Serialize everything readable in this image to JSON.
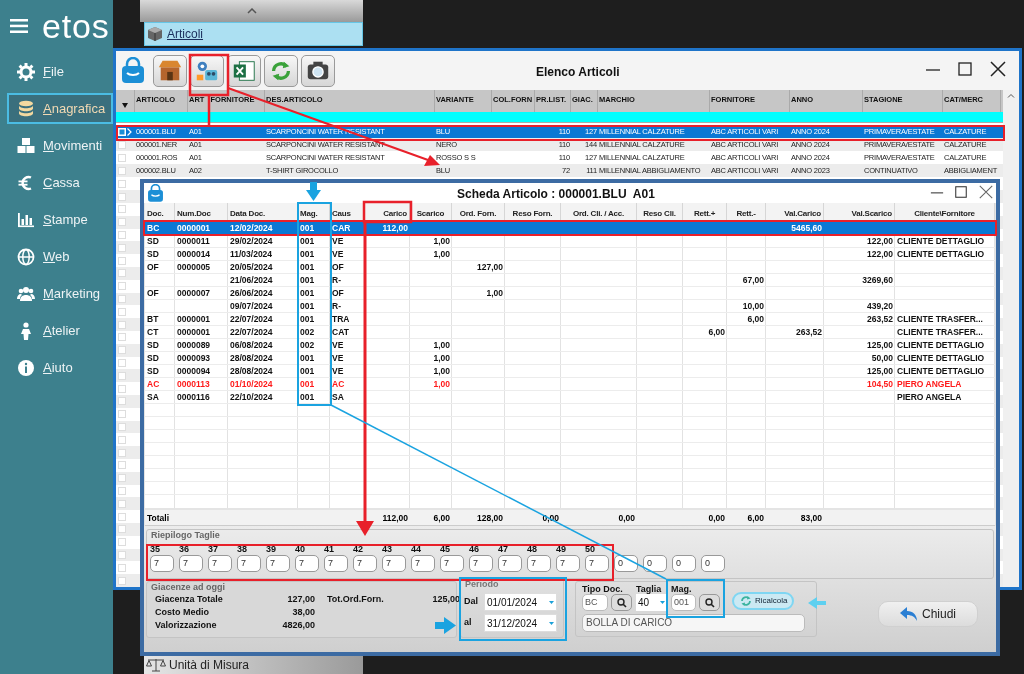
{
  "sidebar": {
    "logo": "etos",
    "items": [
      {
        "label": "File",
        "selected": false
      },
      {
        "label": "Anagrafica",
        "selected": true
      },
      {
        "label": "Movimenti",
        "selected": false
      },
      {
        "label": "Cassa",
        "selected": false
      },
      {
        "label": "Stampe",
        "selected": false
      },
      {
        "label": "Web",
        "selected": false
      },
      {
        "label": "Marketing",
        "selected": false
      },
      {
        "label": "Atelier",
        "selected": false
      },
      {
        "label": "Aiuto",
        "selected": false
      }
    ]
  },
  "top_tab": {
    "label": "Articoli"
  },
  "bottom_tab": {
    "label": "Unità di Misura"
  },
  "list_window": {
    "title": "Elenco Articoli",
    "columns": [
      "ARTICOLO",
      "ART FORNITORE",
      "DES.ARTICOLO",
      "VARIANTE",
      "COL.FORN",
      "PR.LIST.",
      "GIAC.",
      "MARCHIO",
      "FORNITORE",
      "ANNO",
      "STAGIONE",
      "CAT/MERC"
    ],
    "rows": [
      {
        "selected": true,
        "cells": [
          "000001.BLU",
          "A01",
          "SCARPONCINI WATER RESISTANT",
          "BLU",
          "",
          "110",
          "127",
          "MILLENNIAL CALZATURE",
          "ABC ARTICOLI VARI",
          "ANNO 2024",
          "PRIMAVERA/ESTATE",
          "CALZATURE"
        ]
      },
      {
        "selected": false,
        "cells": [
          "000001.NER",
          "A01",
          "SCARPONCINI WATER RESISTANT",
          "NERO",
          "",
          "110",
          "144",
          "MILLENNIAL CALZATURE",
          "ABC ARTICOLI VARI",
          "ANNO 2024",
          "PRIMAVERA/ESTATE",
          "CALZATURE"
        ]
      },
      {
        "selected": false,
        "cells": [
          "000001.ROS",
          "A01",
          "SCARPONCINI WATER RESISTANT",
          "ROSSO S S",
          "",
          "110",
          "127",
          "MILLENNIAL CALZATURE",
          "ABC ARTICOLI VARI",
          "ANNO 2024",
          "PRIMAVERA/ESTATE",
          "CALZATURE"
        ]
      },
      {
        "selected": false,
        "cells": [
          "000002.BLU",
          "A02",
          "T-SHIRT GIROCOLLO",
          "BLU",
          "",
          "72",
          "111",
          "MILLENNIAL ABBIGLIAMENTO",
          "ABC ARTICOLI VARI",
          "ANNO 2023",
          "CONTINUATIVO",
          "ABBIGLIAMENT"
        ]
      }
    ]
  },
  "detail_window": {
    "title": "Scheda Articolo : 000001.BLU  A01",
    "columns": [
      "Doc.",
      "Num.Doc",
      "Data Doc.",
      "Mag.",
      "Caus",
      "Carico",
      "Scarico",
      "Ord. Forn.",
      "Reso Forn.",
      "Ord. Cli. / Acc.",
      "Reso Cli.",
      "Rett.+",
      "Rett.-",
      "Val.Carico",
      "Val.Scarico",
      "Cliente\\Fornitore"
    ],
    "rows": [
      {
        "selected": true,
        "alert": false,
        "cells": [
          "BC",
          "0000001",
          "12/02/2024",
          "001",
          "CAR",
          "112,00",
          "",
          "",
          "",
          "",
          "",
          "",
          "",
          "5465,60",
          "",
          ""
        ]
      },
      {
        "selected": false,
        "alert": false,
        "cells": [
          "SD",
          "0000011",
          "29/02/2024",
          "001",
          "VE",
          "",
          "1,00",
          "",
          "",
          "",
          "",
          "",
          "",
          "",
          "122,00",
          "CLIENTE DETTAGLIO"
        ]
      },
      {
        "selected": false,
        "alert": false,
        "cells": [
          "SD",
          "0000014",
          "11/03/2024",
          "001",
          "VE",
          "",
          "1,00",
          "",
          "",
          "",
          "",
          "",
          "",
          "",
          "122,00",
          "CLIENTE DETTAGLIO"
        ]
      },
      {
        "selected": false,
        "alert": false,
        "cells": [
          "OF",
          "0000005",
          "20/05/2024",
          "001",
          "OF",
          "",
          "",
          "127,00",
          "",
          "",
          "",
          "",
          "",
          "",
          "",
          ""
        ]
      },
      {
        "selected": false,
        "alert": false,
        "cells": [
          "",
          "",
          "21/06/2024",
          "001",
          "R-",
          "",
          "",
          "",
          "",
          "",
          "",
          "",
          "67,00",
          "",
          "3269,60",
          ""
        ]
      },
      {
        "selected": false,
        "alert": false,
        "cells": [
          "OF",
          "0000007",
          "26/06/2024",
          "001",
          "OF",
          "",
          "",
          "1,00",
          "",
          "",
          "",
          "",
          "",
          "",
          "",
          ""
        ]
      },
      {
        "selected": false,
        "alert": false,
        "cells": [
          "",
          "",
          "09/07/2024",
          "001",
          "R-",
          "",
          "",
          "",
          "",
          "",
          "",
          "",
          "10,00",
          "",
          "439,20",
          ""
        ]
      },
      {
        "selected": false,
        "alert": false,
        "cells": [
          "BT",
          "0000001",
          "22/07/2024",
          "001",
          "TRA",
          "",
          "",
          "",
          "",
          "",
          "",
          "",
          "6,00",
          "",
          "263,52",
          "CLIENTE TRASFER..."
        ]
      },
      {
        "selected": false,
        "alert": false,
        "cells": [
          "CT",
          "0000001",
          "22/07/2024",
          "002",
          "CAT",
          "",
          "",
          "",
          "",
          "",
          "",
          "6,00",
          "",
          "263,52",
          "",
          "CLIENTE TRASFER..."
        ]
      },
      {
        "selected": false,
        "alert": false,
        "cells": [
          "SD",
          "0000089",
          "06/08/2024",
          "002",
          "VE",
          "",
          "1,00",
          "",
          "",
          "",
          "",
          "",
          "",
          "",
          "125,00",
          "CLIENTE DETTAGLIO"
        ]
      },
      {
        "selected": false,
        "alert": false,
        "cells": [
          "SD",
          "0000093",
          "28/08/2024",
          "001",
          "VE",
          "",
          "1,00",
          "",
          "",
          "",
          "",
          "",
          "",
          "",
          "50,00",
          "CLIENTE DETTAGLIO"
        ]
      },
      {
        "selected": false,
        "alert": false,
        "cells": [
          "SD",
          "0000094",
          "28/08/2024",
          "001",
          "VE",
          "",
          "1,00",
          "",
          "",
          "",
          "",
          "",
          "",
          "",
          "125,00",
          "CLIENTE DETTAGLIO"
        ]
      },
      {
        "selected": false,
        "alert": true,
        "cells": [
          "AC",
          "0000113",
          "01/10/2024",
          "001",
          "AC",
          "",
          "1,00",
          "",
          "",
          "",
          "",
          "",
          "",
          "",
          "104,50",
          "PIERO ANGELA"
        ]
      },
      {
        "selected": false,
        "alert": false,
        "cells": [
          "SA",
          "0000116",
          "22/10/2024",
          "001",
          "SA",
          "",
          "",
          "",
          "",
          "",
          "",
          "",
          "",
          "",
          "",
          "PIERO ANGELA"
        ]
      }
    ],
    "totals_label": "Totali",
    "totals": {
      "carico": "112,00",
      "scarico": "6,00",
      "ord_forn": "128,00",
      "reso_forn": "0,00",
      "ord_cli": "0,00",
      "rett_plus": "0,00",
      "rett_minus": "6,00",
      "val_carico": "83,00"
    },
    "sizes": {
      "title": "Riepilogo Taglie",
      "items": [
        {
          "label": "35",
          "value": "7"
        },
        {
          "label": "36",
          "value": "7"
        },
        {
          "label": "37",
          "value": "7"
        },
        {
          "label": "38",
          "value": "7"
        },
        {
          "label": "39",
          "value": "7"
        },
        {
          "label": "40",
          "value": "7"
        },
        {
          "label": "41",
          "value": "7"
        },
        {
          "label": "42",
          "value": "7"
        },
        {
          "label": "43",
          "value": "7"
        },
        {
          "label": "44",
          "value": "7"
        },
        {
          "label": "45",
          "value": "7"
        },
        {
          "label": "46",
          "value": "7"
        },
        {
          "label": "47",
          "value": "7"
        },
        {
          "label": "48",
          "value": "7"
        },
        {
          "label": "49",
          "value": "7"
        },
        {
          "label": "50",
          "value": "7"
        },
        {
          "value": "0"
        },
        {
          "value": "0"
        },
        {
          "value": "0"
        },
        {
          "value": "0"
        }
      ]
    },
    "stock": {
      "title": "Giacenze ad oggi",
      "rows": [
        {
          "label": "Giacenza Totale",
          "value": "127,00"
        },
        {
          "label": "Costo Medio",
          "value": "38,00"
        },
        {
          "label": "Valorizzazione",
          "value": "4826,00"
        }
      ],
      "side_label": "Tot.Ord.Forn.",
      "side_value": "125,00"
    },
    "period": {
      "title": "Periodo",
      "from_label": "Dal",
      "from": "01/01/2024",
      "to_label": "al",
      "to": "31/12/2024"
    },
    "filters": {
      "doc_type_label": "Tipo Doc.",
      "doc_type": "BC",
      "size_label": "Taglia",
      "size": "40",
      "store_label": "Mag.",
      "store": "001",
      "description": "BOLLA DI CARICO"
    },
    "recalc_button": "Ricalcola",
    "close_button": "Chiudi"
  }
}
